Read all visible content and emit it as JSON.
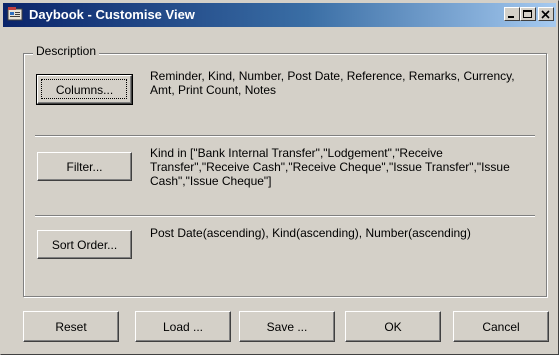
{
  "window": {
    "title": "Daybook - Customise View",
    "app_icon": "daybook-app-icon",
    "controls": {
      "minimize": "minimize-icon",
      "maximize": "maximize-icon",
      "close": "close-icon"
    }
  },
  "group": {
    "label": "Description",
    "columns": {
      "button_label": "Columns...",
      "text": "Reminder, Kind, Number, Post Date, Reference, Remarks, Currency, Amt, Print Count, Notes"
    },
    "filter": {
      "button_label": "Filter...",
      "text": "Kind in [\"Bank Internal Transfer\",\"Lodgement\",\"Receive Transfer\",\"Receive Cash\",\"Receive Cheque\",\"Issue Transfer\",\"Issue Cash\",\"Issue Cheque\"]"
    },
    "sort": {
      "button_label": "Sort Order...",
      "text": "Post Date(ascending), Kind(ascending), Number(ascending)"
    }
  },
  "footer": {
    "reset": "Reset",
    "load": "Load ...",
    "save": "Save ...",
    "ok": "OK",
    "cancel": "Cancel"
  }
}
